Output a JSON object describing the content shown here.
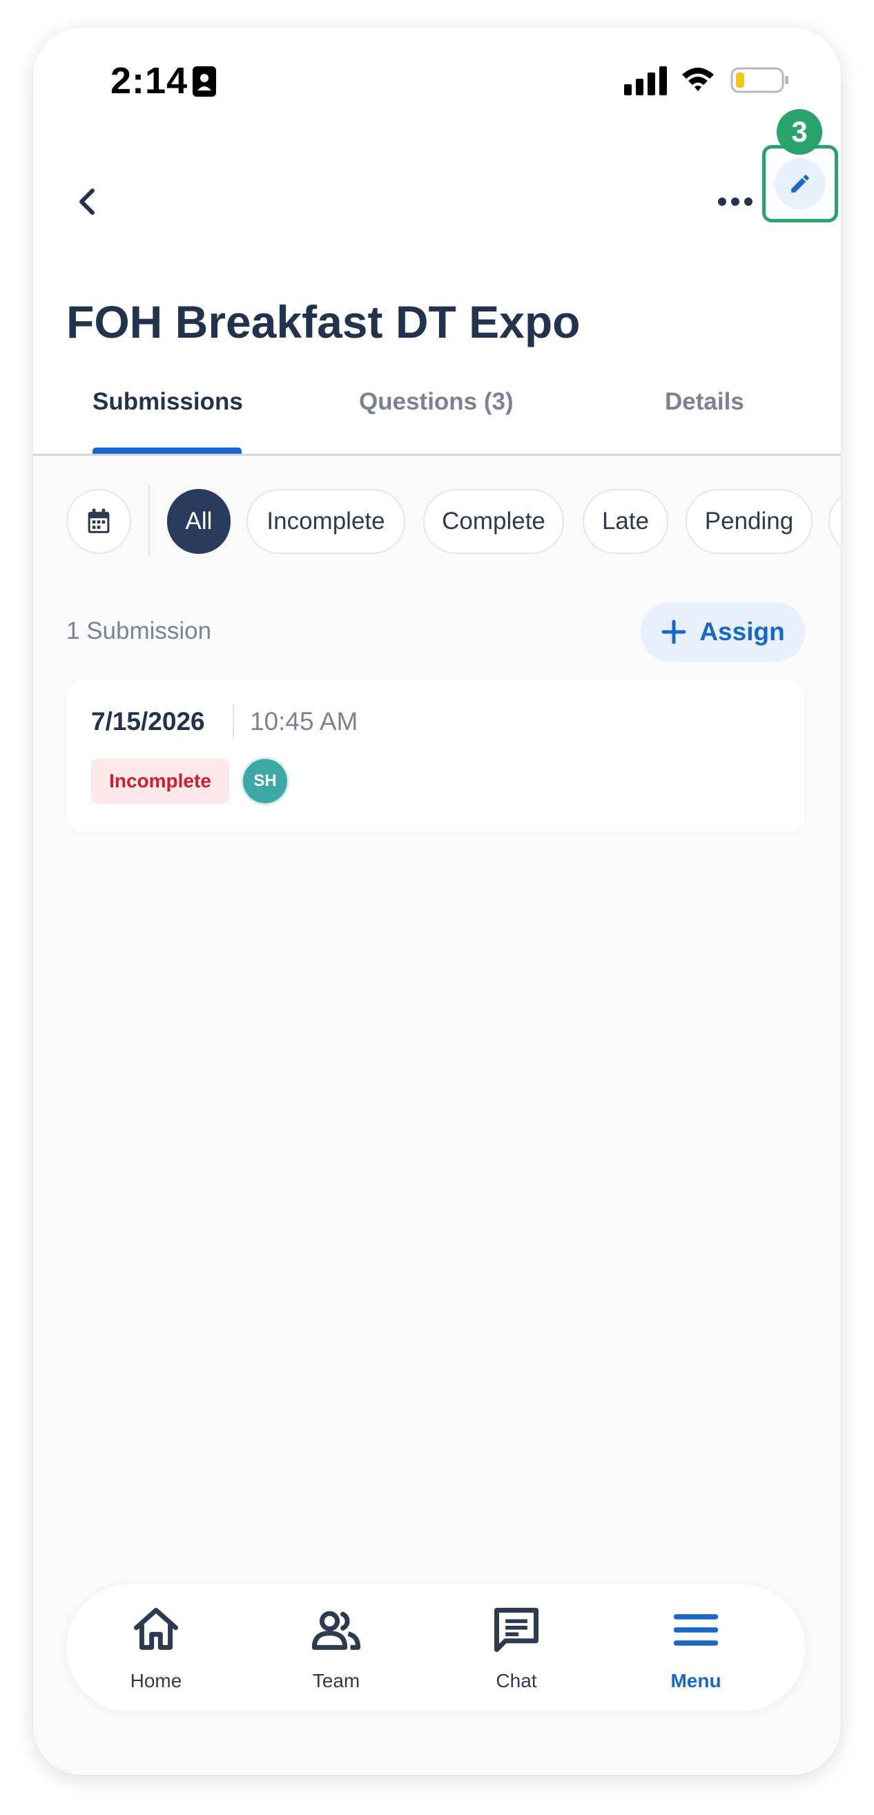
{
  "status_bar": {
    "time": "2:14"
  },
  "header": {
    "step_badge": "3",
    "title": "FOH Breakfast DT Expo"
  },
  "tabs": [
    {
      "label": "Submissions",
      "active": true
    },
    {
      "label": "Questions (3)",
      "active": false
    },
    {
      "label": "Details",
      "active": false
    }
  ],
  "filters": {
    "chips": [
      {
        "label": "All",
        "active": true
      },
      {
        "label": "Incomplete",
        "active": false
      },
      {
        "label": "Complete",
        "active": false
      },
      {
        "label": "Late",
        "active": false
      },
      {
        "label": "Pending",
        "active": false
      }
    ]
  },
  "submissions": {
    "count_label": "1 Submission",
    "assign_label": "Assign",
    "items": [
      {
        "date": "7/15/2026",
        "time": "10:45 AM",
        "status": "Incomplete",
        "assignee_initials": "SH"
      }
    ]
  },
  "bottom_nav": [
    {
      "label": "Home",
      "icon": "home-icon",
      "active": false
    },
    {
      "label": "Team",
      "icon": "team-icon",
      "active": false
    },
    {
      "label": "Chat",
      "icon": "chat-icon",
      "active": false
    },
    {
      "label": "Menu",
      "icon": "menu-icon",
      "active": true
    }
  ],
  "colors": {
    "accent": "#1767cc",
    "title": "#22334f",
    "highlight": "#27a36b",
    "status_incomplete": "#d11a2a",
    "avatar": "#3ea8a6",
    "active_chip": "#2a3c5e"
  }
}
